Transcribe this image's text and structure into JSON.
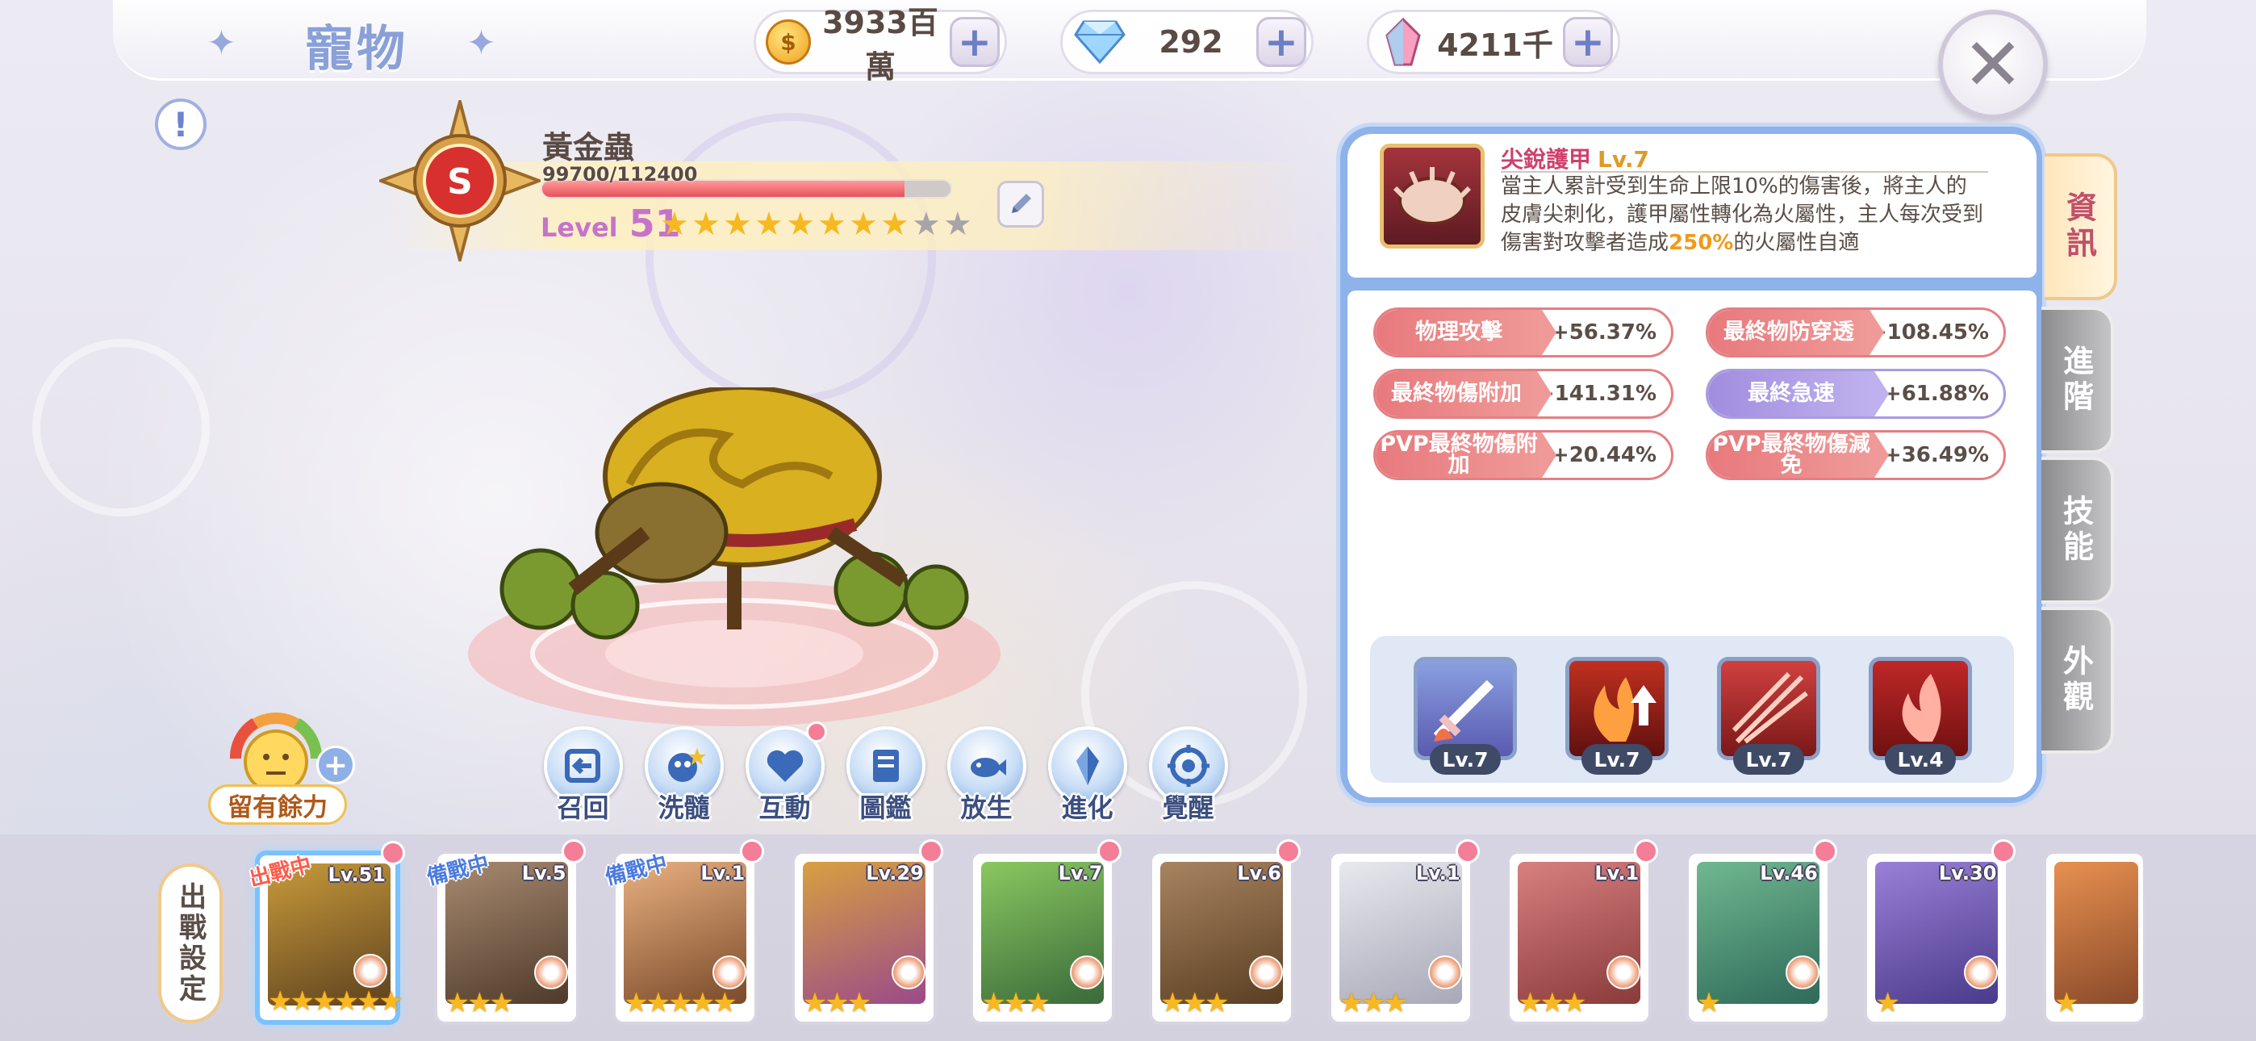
{
  "header": {
    "title": "寵物",
    "resources": [
      {
        "icon": "gold-coin-icon",
        "value": "3933百萬"
      },
      {
        "icon": "diamond-icon",
        "value": "292"
      },
      {
        "icon": "crystal-icon",
        "value": "4211千"
      }
    ],
    "close_icon": "close-icon"
  },
  "pet": {
    "rank": "S",
    "name": "黃金蟲",
    "exp_text": "99700/112400",
    "exp_fraction": 0.8869,
    "level_label": "Level",
    "level": "51",
    "stars_filled": 8,
    "stars_total": 10
  },
  "mood": {
    "label": "留有餘力"
  },
  "actions": [
    {
      "label": "召回",
      "icon": "recall-icon",
      "dot": false
    },
    {
      "label": "洗髓",
      "icon": "reroll-icon",
      "dot": false
    },
    {
      "label": "互動",
      "icon": "heart-icon",
      "dot": true
    },
    {
      "label": "圖鑑",
      "icon": "book-icon",
      "dot": false
    },
    {
      "label": "放生",
      "icon": "release-icon",
      "dot": false
    },
    {
      "label": "進化",
      "icon": "evolve-crystal-icon",
      "dot": false
    },
    {
      "label": "覺醒",
      "icon": "awaken-icon",
      "dot": false
    }
  ],
  "skill": {
    "name": "尖銳護甲",
    "level": "Lv.7",
    "desc_a": "當主人累計受到生命上限10%的傷害後，將主人的皮膚尖刺化，護甲屬性轉化為火屬性，主人每次受到傷害對攻擊者造成",
    "desc_highlight": "250%",
    "desc_b": "的火屬性自適"
  },
  "stats": [
    {
      "name": "物理攻擊",
      "value": "+56.37%",
      "style": "red"
    },
    {
      "name": "最終物防穿透",
      "value": "+108.45%",
      "style": "red"
    },
    {
      "name": "最終物傷附加",
      "value": "+141.31%",
      "style": "red"
    },
    {
      "name": "最終急速",
      "value": "+61.88%",
      "style": "purple"
    },
    {
      "name": "PVP最終物傷附加",
      "value": "+20.44%",
      "style": "red"
    },
    {
      "name": "PVP最終物傷減免",
      "value": "+36.49%",
      "style": "red"
    }
  ],
  "passive_skills": [
    {
      "level": "Lv.7",
      "icon": "sword-fire-icon"
    },
    {
      "level": "Lv.7",
      "icon": "flame-up-icon"
    },
    {
      "level": "Lv.7",
      "icon": "fire-slash-icon"
    },
    {
      "level": "Lv.4",
      "icon": "fire-hand-icon"
    }
  ],
  "tabs": [
    "資訊",
    "進階",
    "技能",
    "外觀"
  ],
  "roster_label": "出戰設定",
  "roster": [
    {
      "level": "Lv.51",
      "stars": 6,
      "tag": "出戰中",
      "tag_color": "#ff5a4a",
      "colors": [
        "#c89a3a",
        "#5e4220"
      ]
    },
    {
      "level": "Lv.5",
      "stars": 3,
      "tag": "備戰中",
      "tag_color": "#4a7ae0",
      "colors": [
        "#a88a70",
        "#4e3a2a"
      ]
    },
    {
      "level": "Lv.1",
      "stars": 5,
      "tag": "備戰中",
      "tag_color": "#4a7ae0",
      "colors": [
        "#e8b080",
        "#7a4a2a"
      ]
    },
    {
      "level": "Lv.29",
      "stars": 3,
      "tag": "",
      "tag_color": "",
      "colors": [
        "#d8a040",
        "#9a4a8a"
      ]
    },
    {
      "level": "Lv.7",
      "stars": 3,
      "tag": "",
      "tag_color": "",
      "colors": [
        "#8ac860",
        "#3a6a3a"
      ]
    },
    {
      "level": "Lv.6",
      "stars": 3,
      "tag": "",
      "tag_color": "",
      "colors": [
        "#a88460",
        "#5a3e22"
      ]
    },
    {
      "level": "Lv.1",
      "stars": 3,
      "tag": "",
      "tag_color": "",
      "colors": [
        "#e8e8ee",
        "#a8a8b8"
      ]
    },
    {
      "level": "Lv.1",
      "stars": 3,
      "tag": "",
      "tag_color": "",
      "colors": [
        "#d88080",
        "#8a3a3a"
      ]
    },
    {
      "level": "Lv.46",
      "stars": 1,
      "tag": "",
      "tag_color": "",
      "colors": [
        "#70b890",
        "#2e6a5a"
      ]
    },
    {
      "level": "Lv.30",
      "stars": 1,
      "tag": "",
      "tag_color": "",
      "colors": [
        "#9a80d8",
        "#4a3a8a"
      ]
    },
    {
      "level": "",
      "stars": 1,
      "tag": "",
      "tag_color": "",
      "colors": [
        "#e89050",
        "#8a4a2a"
      ]
    }
  ]
}
